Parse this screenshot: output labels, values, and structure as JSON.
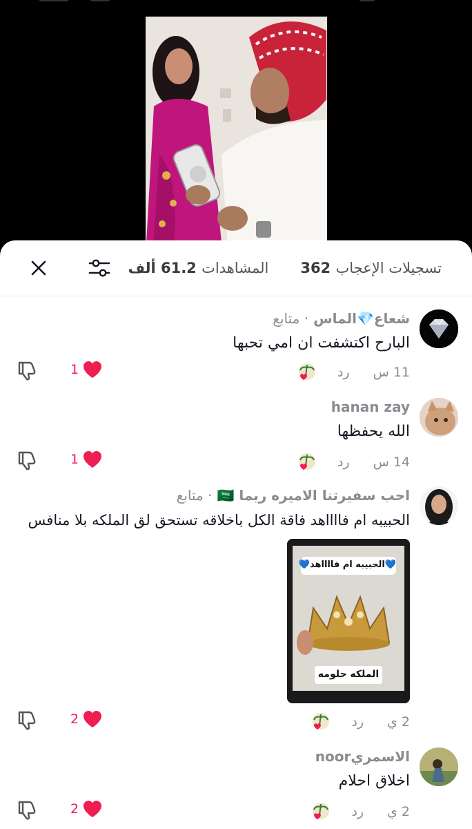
{
  "colors": {
    "accent": "#ee1d52",
    "muted": "#8a8b91",
    "text": "#161823"
  },
  "header": {
    "likes_label": "تسجيلات الإعجاب",
    "likes_count": "362",
    "views_label": "المشاهدات",
    "views_count": "61.2 ألف",
    "filter_icon": "sliders-icon",
    "close_icon": "close-icon"
  },
  "comments": [
    {
      "username": "شعاع💎الماس",
      "follow": "· متابع",
      "text": "البارح اكتشفت ان امي تحبها",
      "time": "11 س",
      "reply": "رد",
      "likes": "1"
    },
    {
      "username": "hanan zay",
      "follow": "",
      "text": "الله يحفظها",
      "time": "14 س",
      "reply": "رد",
      "likes": "1"
    },
    {
      "username": "احب سفيرتنا الاميره ريما 🇸🇦",
      "follow": "· متابع",
      "text": "الحبيبه ام فااااهد فاقة الكل باخلاقه تستحق لق الملكه بلا منافس",
      "sticker_top": "💙الحبيبه ام فااااهد💙",
      "sticker_bottom": "الملكه حلومه",
      "time": "2 ي",
      "reply": "رد",
      "likes": "2"
    },
    {
      "username": "الاسمريnoor",
      "follow": "",
      "text": "اخلاق احلام",
      "time": "2 ي",
      "reply": "رد",
      "likes": "2"
    }
  ]
}
